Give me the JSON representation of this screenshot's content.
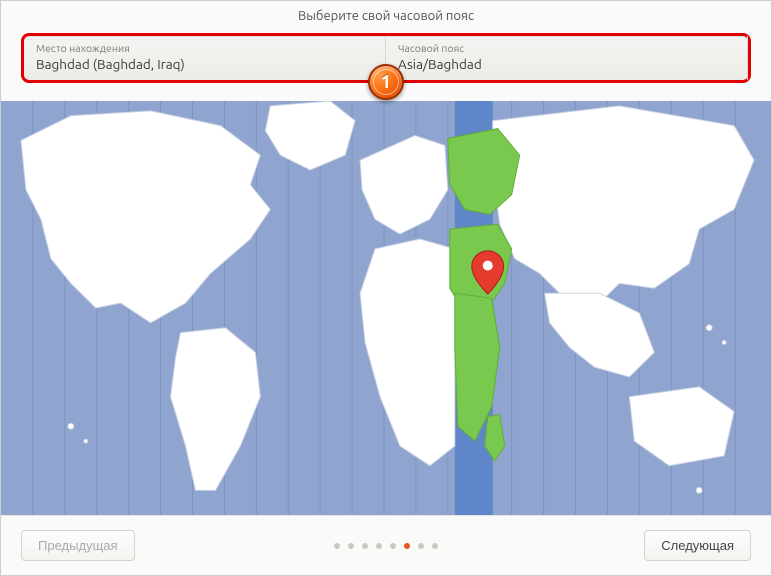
{
  "header": {
    "title": "Выберите свой часовой пояс"
  },
  "fields": {
    "location": {
      "label": "Место нахождения",
      "value": "Baghdad (Baghdad, Iraq)"
    },
    "timezone": {
      "label": "Часовой пояс",
      "value": "Asia/Baghdad"
    }
  },
  "callout": {
    "number": "1"
  },
  "footer": {
    "prev": "Предыдущая",
    "next": "Следующая",
    "steps_total": 8,
    "active_step_index": 5
  },
  "colors": {
    "highlight_border": "#e00000",
    "accent": "#e95420",
    "tz_band": "#5f86c8",
    "tz_region": "#7ac94f",
    "ocean": "#8fa5cf",
    "land": "#ffffff"
  }
}
